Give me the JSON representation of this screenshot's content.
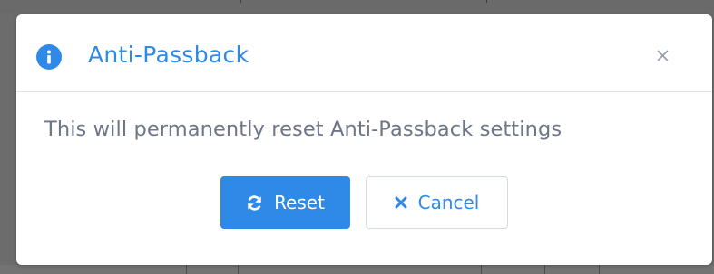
{
  "colors": {
    "accent": "#2f8ae7",
    "body_text": "#6d7689",
    "backdrop": "#6c6c6c",
    "modal_background": "#ffffff"
  },
  "dialog": {
    "title": "Anti-Passback",
    "title_icon": "info-icon",
    "close_icon": "close-icon",
    "message": "This will permanently reset Anti-Passback settings",
    "buttons": {
      "reset": {
        "label": "Reset",
        "icon": "refresh-icon"
      },
      "cancel": {
        "label": "Cancel",
        "icon": "x-icon"
      }
    }
  }
}
